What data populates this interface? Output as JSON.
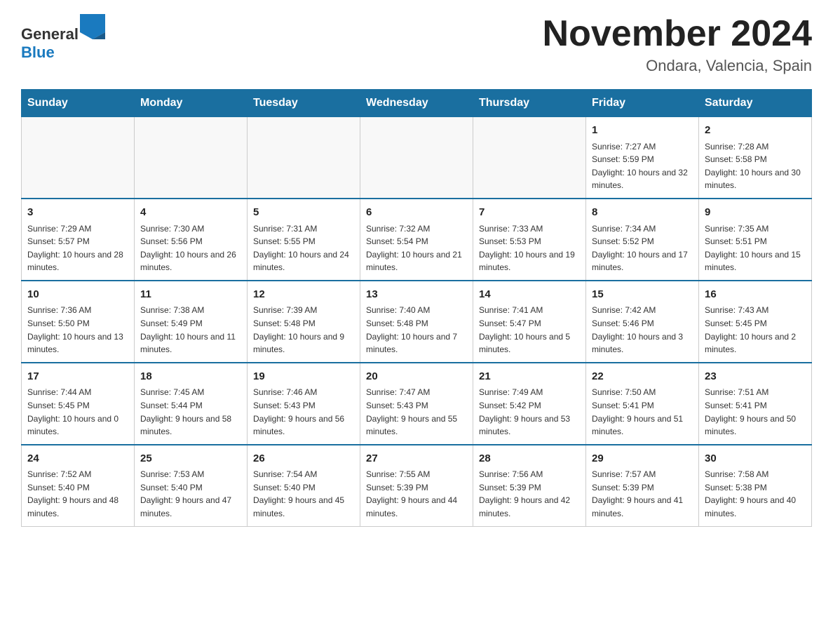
{
  "header": {
    "logo_general": "General",
    "logo_blue": "Blue",
    "month_title": "November 2024",
    "location": "Ondara, Valencia, Spain"
  },
  "days_of_week": [
    "Sunday",
    "Monday",
    "Tuesday",
    "Wednesday",
    "Thursday",
    "Friday",
    "Saturday"
  ],
  "weeks": [
    {
      "days": [
        {
          "num": "",
          "info": ""
        },
        {
          "num": "",
          "info": ""
        },
        {
          "num": "",
          "info": ""
        },
        {
          "num": "",
          "info": ""
        },
        {
          "num": "",
          "info": ""
        },
        {
          "num": "1",
          "info": "Sunrise: 7:27 AM\nSunset: 5:59 PM\nDaylight: 10 hours and 32 minutes."
        },
        {
          "num": "2",
          "info": "Sunrise: 7:28 AM\nSunset: 5:58 PM\nDaylight: 10 hours and 30 minutes."
        }
      ]
    },
    {
      "days": [
        {
          "num": "3",
          "info": "Sunrise: 7:29 AM\nSunset: 5:57 PM\nDaylight: 10 hours and 28 minutes."
        },
        {
          "num": "4",
          "info": "Sunrise: 7:30 AM\nSunset: 5:56 PM\nDaylight: 10 hours and 26 minutes."
        },
        {
          "num": "5",
          "info": "Sunrise: 7:31 AM\nSunset: 5:55 PM\nDaylight: 10 hours and 24 minutes."
        },
        {
          "num": "6",
          "info": "Sunrise: 7:32 AM\nSunset: 5:54 PM\nDaylight: 10 hours and 21 minutes."
        },
        {
          "num": "7",
          "info": "Sunrise: 7:33 AM\nSunset: 5:53 PM\nDaylight: 10 hours and 19 minutes."
        },
        {
          "num": "8",
          "info": "Sunrise: 7:34 AM\nSunset: 5:52 PM\nDaylight: 10 hours and 17 minutes."
        },
        {
          "num": "9",
          "info": "Sunrise: 7:35 AM\nSunset: 5:51 PM\nDaylight: 10 hours and 15 minutes."
        }
      ]
    },
    {
      "days": [
        {
          "num": "10",
          "info": "Sunrise: 7:36 AM\nSunset: 5:50 PM\nDaylight: 10 hours and 13 minutes."
        },
        {
          "num": "11",
          "info": "Sunrise: 7:38 AM\nSunset: 5:49 PM\nDaylight: 10 hours and 11 minutes."
        },
        {
          "num": "12",
          "info": "Sunrise: 7:39 AM\nSunset: 5:48 PM\nDaylight: 10 hours and 9 minutes."
        },
        {
          "num": "13",
          "info": "Sunrise: 7:40 AM\nSunset: 5:48 PM\nDaylight: 10 hours and 7 minutes."
        },
        {
          "num": "14",
          "info": "Sunrise: 7:41 AM\nSunset: 5:47 PM\nDaylight: 10 hours and 5 minutes."
        },
        {
          "num": "15",
          "info": "Sunrise: 7:42 AM\nSunset: 5:46 PM\nDaylight: 10 hours and 3 minutes."
        },
        {
          "num": "16",
          "info": "Sunrise: 7:43 AM\nSunset: 5:45 PM\nDaylight: 10 hours and 2 minutes."
        }
      ]
    },
    {
      "days": [
        {
          "num": "17",
          "info": "Sunrise: 7:44 AM\nSunset: 5:45 PM\nDaylight: 10 hours and 0 minutes."
        },
        {
          "num": "18",
          "info": "Sunrise: 7:45 AM\nSunset: 5:44 PM\nDaylight: 9 hours and 58 minutes."
        },
        {
          "num": "19",
          "info": "Sunrise: 7:46 AM\nSunset: 5:43 PM\nDaylight: 9 hours and 56 minutes."
        },
        {
          "num": "20",
          "info": "Sunrise: 7:47 AM\nSunset: 5:43 PM\nDaylight: 9 hours and 55 minutes."
        },
        {
          "num": "21",
          "info": "Sunrise: 7:49 AM\nSunset: 5:42 PM\nDaylight: 9 hours and 53 minutes."
        },
        {
          "num": "22",
          "info": "Sunrise: 7:50 AM\nSunset: 5:41 PM\nDaylight: 9 hours and 51 minutes."
        },
        {
          "num": "23",
          "info": "Sunrise: 7:51 AM\nSunset: 5:41 PM\nDaylight: 9 hours and 50 minutes."
        }
      ]
    },
    {
      "days": [
        {
          "num": "24",
          "info": "Sunrise: 7:52 AM\nSunset: 5:40 PM\nDaylight: 9 hours and 48 minutes."
        },
        {
          "num": "25",
          "info": "Sunrise: 7:53 AM\nSunset: 5:40 PM\nDaylight: 9 hours and 47 minutes."
        },
        {
          "num": "26",
          "info": "Sunrise: 7:54 AM\nSunset: 5:40 PM\nDaylight: 9 hours and 45 minutes."
        },
        {
          "num": "27",
          "info": "Sunrise: 7:55 AM\nSunset: 5:39 PM\nDaylight: 9 hours and 44 minutes."
        },
        {
          "num": "28",
          "info": "Sunrise: 7:56 AM\nSunset: 5:39 PM\nDaylight: 9 hours and 42 minutes."
        },
        {
          "num": "29",
          "info": "Sunrise: 7:57 AM\nSunset: 5:39 PM\nDaylight: 9 hours and 41 minutes."
        },
        {
          "num": "30",
          "info": "Sunrise: 7:58 AM\nSunset: 5:38 PM\nDaylight: 9 hours and 40 minutes."
        }
      ]
    }
  ]
}
